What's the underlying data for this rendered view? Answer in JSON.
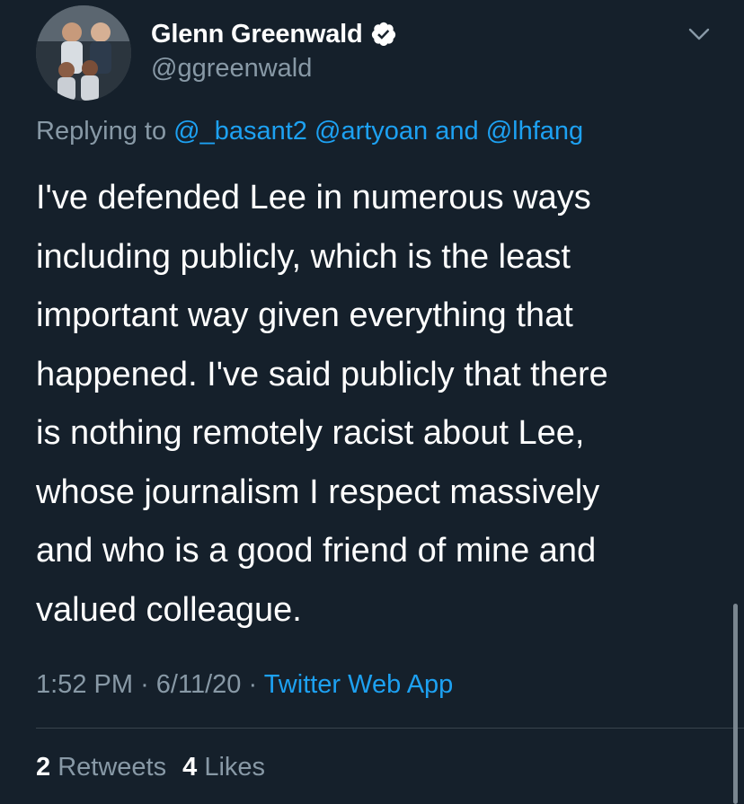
{
  "author": {
    "name": "Glenn Greenwald",
    "handle": "@ggreenwald",
    "verified": true
  },
  "reply_context": {
    "prefix": "Replying to",
    "mention1": "@_basant2",
    "mention2": "@artyoan",
    "conjunction": "and",
    "mention3": "@lhfang"
  },
  "tweet": {
    "lines": [
      "I've defended Lee in numerous ways",
      "including publicly, which is the least",
      "important way given everything that",
      "happened. I've said publicly that there",
      "is nothing remotely racist about Lee,",
      "whose journalism I respect massively",
      "and who is a good friend of mine and",
      "valued colleague."
    ]
  },
  "meta": {
    "time": "1:52 PM",
    "separator": "·",
    "date": "6/11/20",
    "source": "Twitter Web App"
  },
  "stats": {
    "retweets_count": "2",
    "retweets_label": "Retweets",
    "likes_count": "4",
    "likes_label": "Likes"
  },
  "icons": {
    "verified": "verified-badge-icon",
    "more": "chevron-down-icon"
  },
  "colors": {
    "background": "#15202b",
    "text": "#ffffff",
    "secondary": "#8899a6",
    "link": "#1da1f2",
    "divider": "#38444d"
  }
}
